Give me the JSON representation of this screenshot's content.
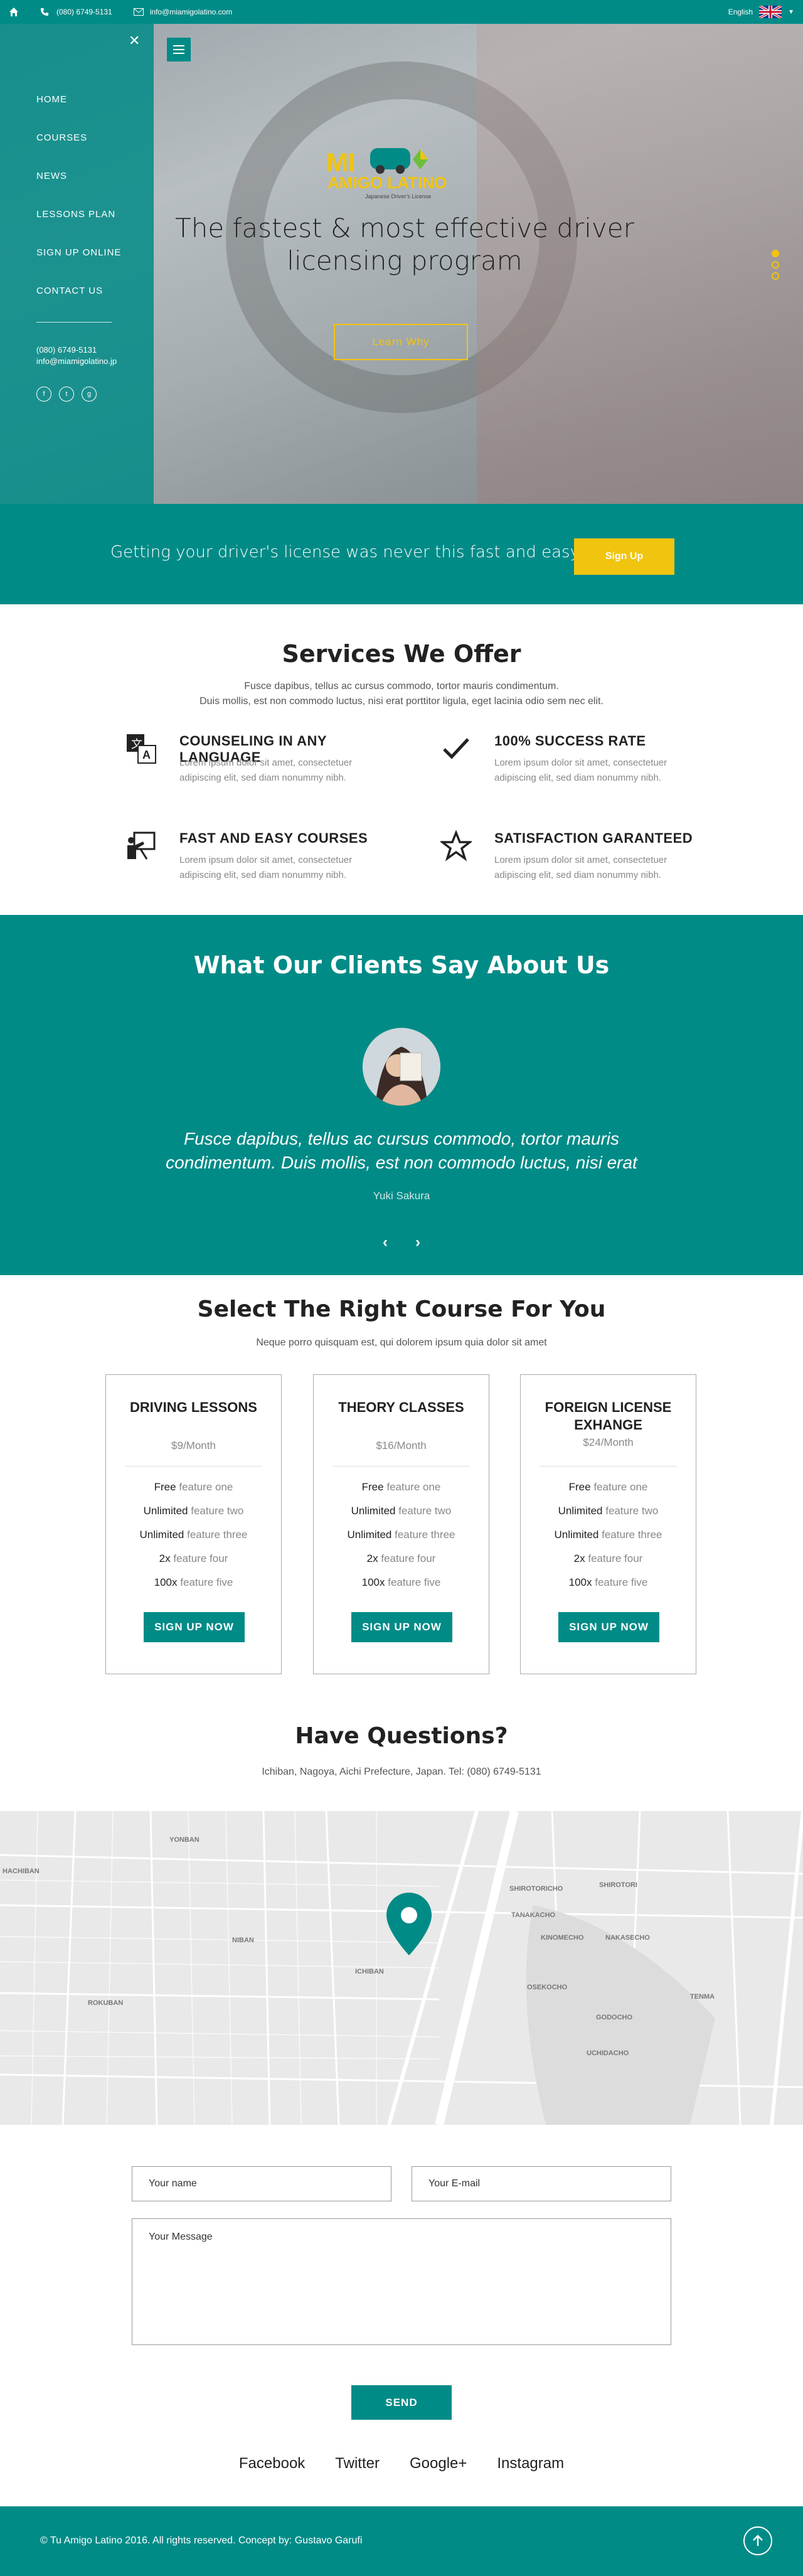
{
  "topbar": {
    "phone": "(080) 6749-5131",
    "email": "info@miamigolatino.com",
    "language": "English"
  },
  "sidebar": {
    "items": [
      {
        "label": "HOME"
      },
      {
        "label": "COURSES"
      },
      {
        "label": "NEWS"
      },
      {
        "label": "LESSONS PLAN"
      },
      {
        "label": "SIGN UP ONLINE"
      },
      {
        "label": "CONTACT US"
      }
    ],
    "phone": "(080) 6749-5131",
    "email": "info@miamigolatino.jp"
  },
  "hero": {
    "logo_text_1": "MI",
    "logo_text_2": "AMIGO LATINO",
    "logo_tagline": "Japanese Driver's License",
    "headline_1": "The fastest & most effective driver",
    "headline_2": "licensing program",
    "button": "Learn Why"
  },
  "banner": {
    "text": "Getting your driver's license was never this fast and easy",
    "button": "Sign Up"
  },
  "services": {
    "title": "Services We Offer",
    "subtitle_1": "Fusce dapibus, tellus ac cursus commodo, tortor mauris condimentum.",
    "subtitle_2": "Duis mollis, est non commodo luctus, nisi erat porttitor ligula, eget lacinia odio sem nec elit.",
    "items": [
      {
        "title": "COUNSELING IN ANY LANGUAGE",
        "text": "Lorem ipsum dolor sit amet, consectetuer adipiscing elit, sed diam nonummy nibh.",
        "icon": "translate-icon"
      },
      {
        "title": "100% SUCCESS RATE",
        "text": "Lorem ipsum dolor sit amet, consectetuer adipiscing elit, sed diam nonummy nibh.",
        "icon": "checkmark-icon"
      },
      {
        "title": "FAST AND EASY COURSES",
        "text": "Lorem ipsum dolor sit amet, consectetuer adipiscing elit, sed diam nonummy nibh.",
        "icon": "teacher-icon"
      },
      {
        "title": "SATISFACTION GARANTEED",
        "text": "Lorem ipsum dolor sit amet, consectetuer adipiscing elit, sed diam nonummy nibh.",
        "icon": "star-icon"
      }
    ]
  },
  "testimonials": {
    "title": "What Our Clients Say About Us",
    "quote_1": "Fusce dapibus, tellus ac cursus commodo, tortor mauris",
    "quote_2": "condimentum. Duis mollis, est non commodo luctus, nisi erat",
    "author": "Yuki Sakura"
  },
  "courses": {
    "title": "Select The Right Course For You",
    "subtitle": "Neque porro quisquam est, qui dolorem ipsum quia dolor sit amet",
    "plans": [
      {
        "name_1": "DRIVING LESSONS",
        "name_2": "",
        "price": "$9/Month"
      },
      {
        "name_1": "THEORY CLASSES",
        "name_2": "",
        "price": "$16/Month"
      },
      {
        "name_1": "FOREIGN LICENSE",
        "name_2": "EXHANGE",
        "price": "$24/Month"
      }
    ],
    "features": [
      {
        "qty": "Free",
        "label": "feature one"
      },
      {
        "qty": "Unlimited",
        "label": "feature two"
      },
      {
        "qty": "Unlimited",
        "label": "feature three"
      },
      {
        "qty": "2x",
        "label": "feature four"
      },
      {
        "qty": "100x",
        "label": "feature five"
      }
    ],
    "button": "SIGN UP NOW"
  },
  "contact": {
    "title": "Have Questions?",
    "address": "Ichiban, Nagoya, Aichi Prefecture, Japan. Tel: (080) 6749-5131",
    "map_labels": [
      "YONBAN",
      "ICHIBAN",
      "NIBAN",
      "ROKUBAN",
      "SHIROTORICHO",
      "TANAKACHO",
      "KINOMECHO",
      "NAKASECHO",
      "OSEKOCHO",
      "GODOCHO",
      "UCHIDACHO",
      "TENMA",
      "SHIROTORI",
      "HACHIBAN"
    ],
    "name_placeholder": "Your name",
    "email_placeholder": "Your E-mail",
    "message_placeholder": "Your Message",
    "send": "SEND"
  },
  "social": [
    "Facebook",
    "Twitter",
    "Google+",
    "Instagram"
  ],
  "footer": {
    "copyright": "© Tu Amigo Latino 2016. All rights reserved. Concept by: Gustavo Garufi"
  }
}
